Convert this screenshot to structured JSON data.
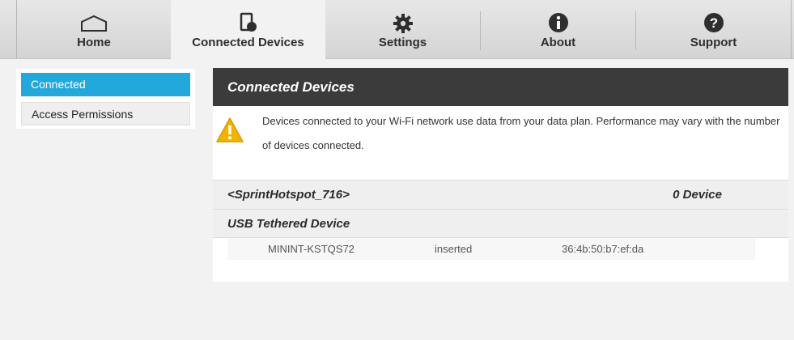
{
  "nav": {
    "tabs": [
      {
        "label": "Home",
        "icon": "home-icon"
      },
      {
        "label": "Connected Devices",
        "icon": "device-icon"
      },
      {
        "label": "Settings",
        "icon": "gear-icon"
      },
      {
        "label": "About",
        "icon": "info-icon"
      },
      {
        "label": "Support",
        "icon": "help-icon"
      }
    ],
    "active": "Connected Devices"
  },
  "sidebar": {
    "items": [
      {
        "label": "Connected",
        "active": true
      },
      {
        "label": "Access Permissions",
        "active": false
      }
    ]
  },
  "panel": {
    "title": "Connected Devices",
    "notice": "Devices connected to your Wi-Fi network use data from your data plan. Performance may vary with the number of devices connected.",
    "wifi": {
      "ssid": "<SprintHotspot_716>",
      "count": "0 Device"
    },
    "usb": {
      "title": "USB Tethered Device",
      "devices": [
        {
          "name": "MININT-KSTQS72",
          "status": "inserted",
          "mac": "36:4b:50:b7:ef:da"
        }
      ]
    }
  },
  "colors": {
    "accent": "#23a8dc",
    "header": "#3b3b3b",
    "warning": "#f0b400"
  }
}
